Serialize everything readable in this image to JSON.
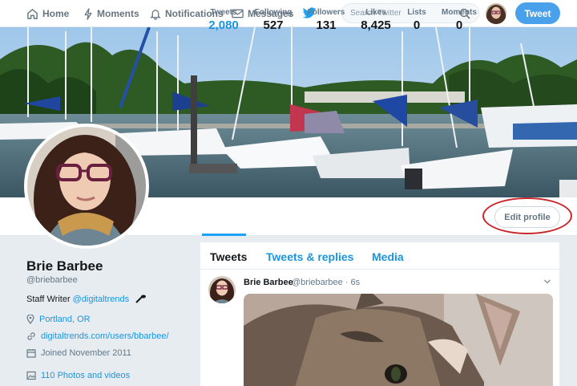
{
  "nav": {
    "home": "Home",
    "moments": "Moments",
    "notifications": "Notifications",
    "messages": "Messages",
    "search_placeholder": "Search Twitter",
    "tweet_button": "Tweet"
  },
  "stats": [
    {
      "label": "Tweets",
      "value": "2,080"
    },
    {
      "label": "Following",
      "value": "527"
    },
    {
      "label": "Followers",
      "value": "131"
    },
    {
      "label": "Likes",
      "value": "8,425"
    },
    {
      "label": "Lists",
      "value": "0"
    },
    {
      "label": "Moments",
      "value": "0"
    }
  ],
  "edit_profile": "Edit profile",
  "profile": {
    "name": "Brie Barbee",
    "handle": "@briebarbee",
    "bio_text": "Staff Writer",
    "bio_link": "@digitaltrends",
    "location": "Portland, OR",
    "website": "digitaltrends.com/users/bbarbee/",
    "joined": "Joined November 2011",
    "media": "110 Photos and videos"
  },
  "timeline": {
    "tabs": [
      "Tweets",
      "Tweets & replies",
      "Media"
    ],
    "tweet": {
      "name": "Brie Barbee",
      "handle_time": "@briebarbee · 6s"
    }
  },
  "colors": {
    "accent": "#1da1f2",
    "link": "#1b95e0",
    "highlight_circle": "#c9262c"
  }
}
